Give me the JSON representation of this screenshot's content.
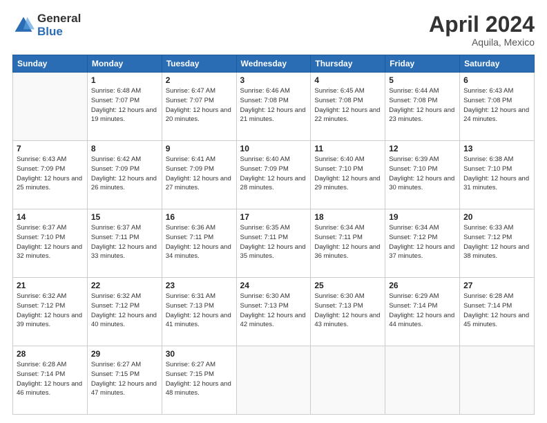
{
  "header": {
    "logo_general": "General",
    "logo_blue": "Blue",
    "month_title": "April 2024",
    "location": "Aquila, Mexico"
  },
  "weekdays": [
    "Sunday",
    "Monday",
    "Tuesday",
    "Wednesday",
    "Thursday",
    "Friday",
    "Saturday"
  ],
  "weeks": [
    [
      {
        "day": "",
        "sunrise": "",
        "sunset": "",
        "daylight": ""
      },
      {
        "day": "1",
        "sunrise": "Sunrise: 6:48 AM",
        "sunset": "Sunset: 7:07 PM",
        "daylight": "Daylight: 12 hours and 19 minutes."
      },
      {
        "day": "2",
        "sunrise": "Sunrise: 6:47 AM",
        "sunset": "Sunset: 7:07 PM",
        "daylight": "Daylight: 12 hours and 20 minutes."
      },
      {
        "day": "3",
        "sunrise": "Sunrise: 6:46 AM",
        "sunset": "Sunset: 7:08 PM",
        "daylight": "Daylight: 12 hours and 21 minutes."
      },
      {
        "day": "4",
        "sunrise": "Sunrise: 6:45 AM",
        "sunset": "Sunset: 7:08 PM",
        "daylight": "Daylight: 12 hours and 22 minutes."
      },
      {
        "day": "5",
        "sunrise": "Sunrise: 6:44 AM",
        "sunset": "Sunset: 7:08 PM",
        "daylight": "Daylight: 12 hours and 23 minutes."
      },
      {
        "day": "6",
        "sunrise": "Sunrise: 6:43 AM",
        "sunset": "Sunset: 7:08 PM",
        "daylight": "Daylight: 12 hours and 24 minutes."
      }
    ],
    [
      {
        "day": "7",
        "sunrise": "Sunrise: 6:43 AM",
        "sunset": "Sunset: 7:09 PM",
        "daylight": "Daylight: 12 hours and 25 minutes."
      },
      {
        "day": "8",
        "sunrise": "Sunrise: 6:42 AM",
        "sunset": "Sunset: 7:09 PM",
        "daylight": "Daylight: 12 hours and 26 minutes."
      },
      {
        "day": "9",
        "sunrise": "Sunrise: 6:41 AM",
        "sunset": "Sunset: 7:09 PM",
        "daylight": "Daylight: 12 hours and 27 minutes."
      },
      {
        "day": "10",
        "sunrise": "Sunrise: 6:40 AM",
        "sunset": "Sunset: 7:09 PM",
        "daylight": "Daylight: 12 hours and 28 minutes."
      },
      {
        "day": "11",
        "sunrise": "Sunrise: 6:40 AM",
        "sunset": "Sunset: 7:10 PM",
        "daylight": "Daylight: 12 hours and 29 minutes."
      },
      {
        "day": "12",
        "sunrise": "Sunrise: 6:39 AM",
        "sunset": "Sunset: 7:10 PM",
        "daylight": "Daylight: 12 hours and 30 minutes."
      },
      {
        "day": "13",
        "sunrise": "Sunrise: 6:38 AM",
        "sunset": "Sunset: 7:10 PM",
        "daylight": "Daylight: 12 hours and 31 minutes."
      }
    ],
    [
      {
        "day": "14",
        "sunrise": "Sunrise: 6:37 AM",
        "sunset": "Sunset: 7:10 PM",
        "daylight": "Daylight: 12 hours and 32 minutes."
      },
      {
        "day": "15",
        "sunrise": "Sunrise: 6:37 AM",
        "sunset": "Sunset: 7:11 PM",
        "daylight": "Daylight: 12 hours and 33 minutes."
      },
      {
        "day": "16",
        "sunrise": "Sunrise: 6:36 AM",
        "sunset": "Sunset: 7:11 PM",
        "daylight": "Daylight: 12 hours and 34 minutes."
      },
      {
        "day": "17",
        "sunrise": "Sunrise: 6:35 AM",
        "sunset": "Sunset: 7:11 PM",
        "daylight": "Daylight: 12 hours and 35 minutes."
      },
      {
        "day": "18",
        "sunrise": "Sunrise: 6:34 AM",
        "sunset": "Sunset: 7:11 PM",
        "daylight": "Daylight: 12 hours and 36 minutes."
      },
      {
        "day": "19",
        "sunrise": "Sunrise: 6:34 AM",
        "sunset": "Sunset: 7:12 PM",
        "daylight": "Daylight: 12 hours and 37 minutes."
      },
      {
        "day": "20",
        "sunrise": "Sunrise: 6:33 AM",
        "sunset": "Sunset: 7:12 PM",
        "daylight": "Daylight: 12 hours and 38 minutes."
      }
    ],
    [
      {
        "day": "21",
        "sunrise": "Sunrise: 6:32 AM",
        "sunset": "Sunset: 7:12 PM",
        "daylight": "Daylight: 12 hours and 39 minutes."
      },
      {
        "day": "22",
        "sunrise": "Sunrise: 6:32 AM",
        "sunset": "Sunset: 7:12 PM",
        "daylight": "Daylight: 12 hours and 40 minutes."
      },
      {
        "day": "23",
        "sunrise": "Sunrise: 6:31 AM",
        "sunset": "Sunset: 7:13 PM",
        "daylight": "Daylight: 12 hours and 41 minutes."
      },
      {
        "day": "24",
        "sunrise": "Sunrise: 6:30 AM",
        "sunset": "Sunset: 7:13 PM",
        "daylight": "Daylight: 12 hours and 42 minutes."
      },
      {
        "day": "25",
        "sunrise": "Sunrise: 6:30 AM",
        "sunset": "Sunset: 7:13 PM",
        "daylight": "Daylight: 12 hours and 43 minutes."
      },
      {
        "day": "26",
        "sunrise": "Sunrise: 6:29 AM",
        "sunset": "Sunset: 7:14 PM",
        "daylight": "Daylight: 12 hours and 44 minutes."
      },
      {
        "day": "27",
        "sunrise": "Sunrise: 6:28 AM",
        "sunset": "Sunset: 7:14 PM",
        "daylight": "Daylight: 12 hours and 45 minutes."
      }
    ],
    [
      {
        "day": "28",
        "sunrise": "Sunrise: 6:28 AM",
        "sunset": "Sunset: 7:14 PM",
        "daylight": "Daylight: 12 hours and 46 minutes."
      },
      {
        "day": "29",
        "sunrise": "Sunrise: 6:27 AM",
        "sunset": "Sunset: 7:15 PM",
        "daylight": "Daylight: 12 hours and 47 minutes."
      },
      {
        "day": "30",
        "sunrise": "Sunrise: 6:27 AM",
        "sunset": "Sunset: 7:15 PM",
        "daylight": "Daylight: 12 hours and 48 minutes."
      },
      {
        "day": "",
        "sunrise": "",
        "sunset": "",
        "daylight": ""
      },
      {
        "day": "",
        "sunrise": "",
        "sunset": "",
        "daylight": ""
      },
      {
        "day": "",
        "sunrise": "",
        "sunset": "",
        "daylight": ""
      },
      {
        "day": "",
        "sunrise": "",
        "sunset": "",
        "daylight": ""
      }
    ]
  ]
}
